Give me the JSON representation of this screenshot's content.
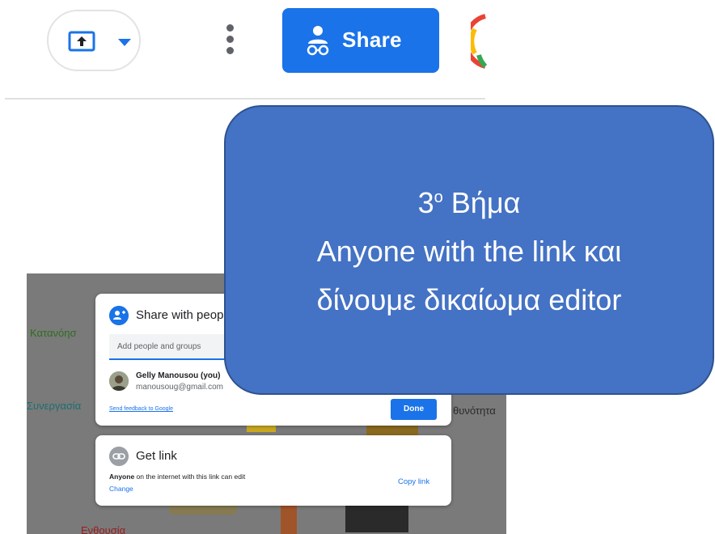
{
  "toolbar": {
    "upload_icon": "upload-arrow-icon",
    "upload_caret_icon": "chevron-down-icon",
    "more_icon": "more-vert-icon",
    "share_label": "Share",
    "share_icon": "share-people-icon"
  },
  "slide": {
    "text1": "Κατανόησ",
    "text2": "Συνεργασία",
    "text3": "Ενθουσία",
    "text4": "θυνότητα"
  },
  "share_dialog": {
    "title": "Share with peop",
    "input_placeholder": "Add people and groups",
    "user_name": "Gelly Manousou (you)",
    "user_email": "manousoug@gmail.com",
    "feedback_link": "Send feedback to Google",
    "done_label": "Done"
  },
  "get_link": {
    "title": "Get link",
    "desc_bold": "Anyone",
    "desc_rest": " on the internet with this link can edit",
    "change_label": "Change",
    "copy_label": "Copy link"
  },
  "callout": {
    "step_number": "3",
    "step_superscript": "ο",
    "step_word": " Βήμα",
    "line2": "Anyone with the link και",
    "line3": "δίνουμε δικαίωμα editor"
  },
  "colors": {
    "accent": "#1a73e8",
    "callout_fill": "#4472c4",
    "callout_border": "#2f528f"
  }
}
